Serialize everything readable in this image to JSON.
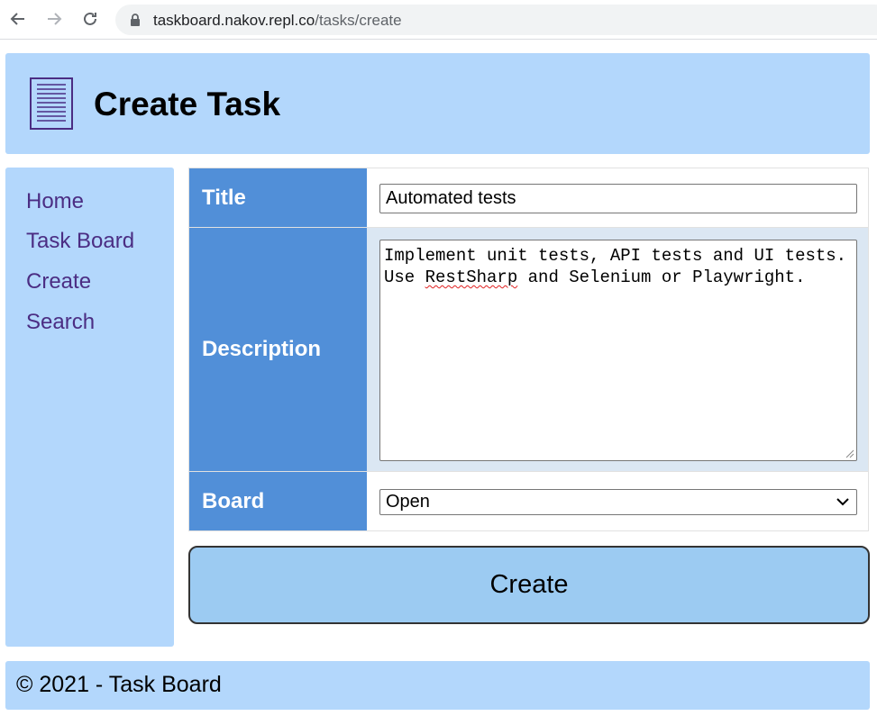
{
  "browser": {
    "url_host": "taskboard.nakov.repl.co",
    "url_path": "/tasks/create"
  },
  "header": {
    "title": "Create Task",
    "icon": "document-icon"
  },
  "sidebar": {
    "items": [
      {
        "label": "Home"
      },
      {
        "label": "Task Board"
      },
      {
        "label": "Create"
      },
      {
        "label": "Search"
      }
    ]
  },
  "form": {
    "title_label": "Title",
    "title_value": "Automated tests",
    "description_label": "Description",
    "description_before": "Implement unit tests, API tests and UI tests.\nUse ",
    "description_misspelled": "RestSharp",
    "description_after": " and Selenium or Playwright.",
    "board_label": "Board",
    "board_value": "Open",
    "submit_label": "Create"
  },
  "footer": {
    "text": "© 2021 - Task Board"
  },
  "colors": {
    "header_bg": "#b3d7fc",
    "label_bg": "#518fd8",
    "button_bg": "#9ccbf2",
    "link": "#4b2d83"
  }
}
